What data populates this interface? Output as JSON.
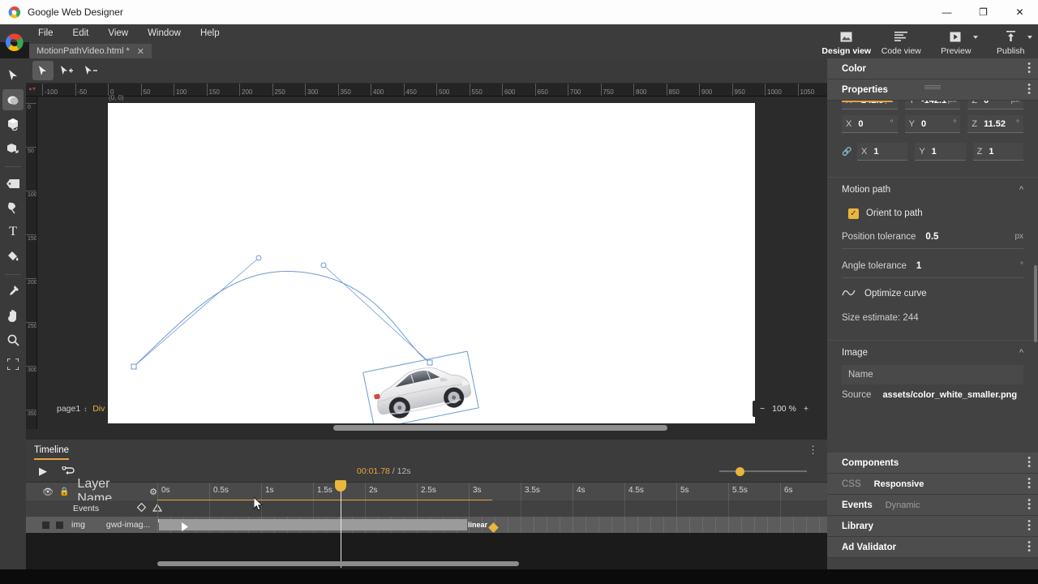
{
  "window": {
    "title": "Google Web Designer",
    "controls": {
      "minimize": "—",
      "maximize": "❐",
      "close": "✕"
    }
  },
  "menubar": {
    "items": [
      "File",
      "Edit",
      "View",
      "Window",
      "Help"
    ]
  },
  "tabs": [
    {
      "label": "MotionPathVideo.html *",
      "close": "✕"
    }
  ],
  "viewbar": [
    {
      "label": "Design view",
      "icon": "image-icon",
      "active": true,
      "caret": false
    },
    {
      "label": "Code view",
      "icon": "code-lines-icon",
      "active": false,
      "caret": false
    },
    {
      "label": "Preview",
      "icon": "play-box-icon",
      "active": false,
      "caret": true
    },
    {
      "label": "Publish",
      "icon": "upload-icon",
      "active": false,
      "caret": true
    }
  ],
  "tools": [
    {
      "name": "selection-tool",
      "glyph": "➤",
      "selected": false
    },
    {
      "name": "shape-tool",
      "glyph": "⬬",
      "selected": true
    },
    {
      "name": "3d-rotate-tool",
      "glyph": "⬡",
      "selected": false
    },
    {
      "name": "3d-translate-tool",
      "glyph": "⬣",
      "selected": false
    },
    {
      "name": "tag-tool",
      "glyph": "⬟",
      "selected": false
    },
    {
      "name": "pen-tool",
      "glyph": "✒",
      "selected": false
    },
    {
      "name": "text-tool",
      "glyph": "T",
      "selected": false
    },
    {
      "name": "paint-bucket-tool",
      "glyph": "⛃",
      "selected": false
    },
    {
      "name": "eyedropper-tool",
      "glyph": "✄",
      "selected": false
    },
    {
      "name": "hand-tool",
      "glyph": "✋",
      "selected": false
    },
    {
      "name": "zoom-tool",
      "glyph": "⌕",
      "selected": false
    },
    {
      "name": "fullscreen-tool",
      "glyph": "⛶",
      "selected": false
    }
  ],
  "subtools": [
    {
      "name": "direct-select-tool",
      "glyph": "➤",
      "selected": true
    },
    {
      "name": "add-anchor-tool",
      "glyph": "➤",
      "badge": "+",
      "selected": false
    },
    {
      "name": "remove-anchor-tool",
      "glyph": "➤",
      "badge": "−",
      "selected": false
    }
  ],
  "rulers": {
    "origin_label": "(0, 0)",
    "horizontal": [
      -100,
      -50,
      0,
      50,
      100,
      150,
      200,
      250,
      300,
      350,
      400,
      450,
      500,
      550,
      600,
      650,
      700,
      750,
      800,
      850,
      900,
      950,
      1000,
      1050
    ],
    "vertical": [
      0,
      50,
      100,
      150,
      200,
      250,
      300,
      350
    ]
  },
  "stage": {
    "page_label": "page1",
    "element_label": "Div",
    "zoom_minus": "−",
    "zoom_value": "100 %",
    "zoom_plus": "+"
  },
  "timeline": {
    "panel_title": "Timeline",
    "play_glyph": "▶",
    "loop_glyph": "↺",
    "current_time": "00:01.78",
    "total_time": "/ 12s",
    "columns": {
      "layer_name": "Layer Name",
      "events": "Events"
    },
    "ticks": [
      "0s",
      "0.5s",
      "1s",
      "1.5s",
      "2s",
      "2.5s",
      "3s",
      "3.5s",
      "4s",
      "4.5s",
      "5s",
      "5.5s",
      "6s"
    ],
    "layer": {
      "name": "img",
      "type": "gwd-imag...",
      "easing": "linear"
    }
  },
  "properties": {
    "sections": {
      "color": "Color",
      "properties": "Properties",
      "components": "Components",
      "css": "CSS",
      "css_value": "Responsive",
      "events": "Events",
      "events_value": "Dynamic",
      "library": "Library",
      "ad_validator": "Ad Validator"
    },
    "rotation": [
      {
        "axis": "X",
        "value": "0",
        "unit": "°"
      },
      {
        "axis": "Y",
        "value": "0",
        "unit": "°"
      },
      {
        "axis": "Z",
        "value": "11.52",
        "unit": "°"
      }
    ],
    "scale": [
      {
        "axis": "X",
        "value": "1",
        "unit": ""
      },
      {
        "axis": "Y",
        "value": "1",
        "unit": ""
      },
      {
        "axis": "Z",
        "value": "1",
        "unit": ""
      }
    ],
    "motion_path": {
      "title": "Motion path",
      "orient_to_path": "Orient to path",
      "orient_checked": true,
      "position_tolerance_label": "Position tolerance",
      "position_tolerance_value": "0.5",
      "position_tolerance_unit": "px",
      "angle_tolerance_label": "Angle tolerance",
      "angle_tolerance_value": "1",
      "angle_tolerance_unit": "°",
      "optimize_curve": "Optimize curve",
      "size_estimate": "Size estimate: 244"
    },
    "image": {
      "title": "Image",
      "name_label": "Name",
      "source_label": "Source",
      "source_value": "assets/color_white_smaller.png"
    }
  },
  "colors": {
    "accent": "#e8a33d",
    "keyframe": "#e8b73b",
    "panel_bg": "#424242",
    "chrome_bg": "#3c3c3c",
    "canvas_bg": "#ffffff",
    "path_stroke": "#6c9ad6"
  }
}
